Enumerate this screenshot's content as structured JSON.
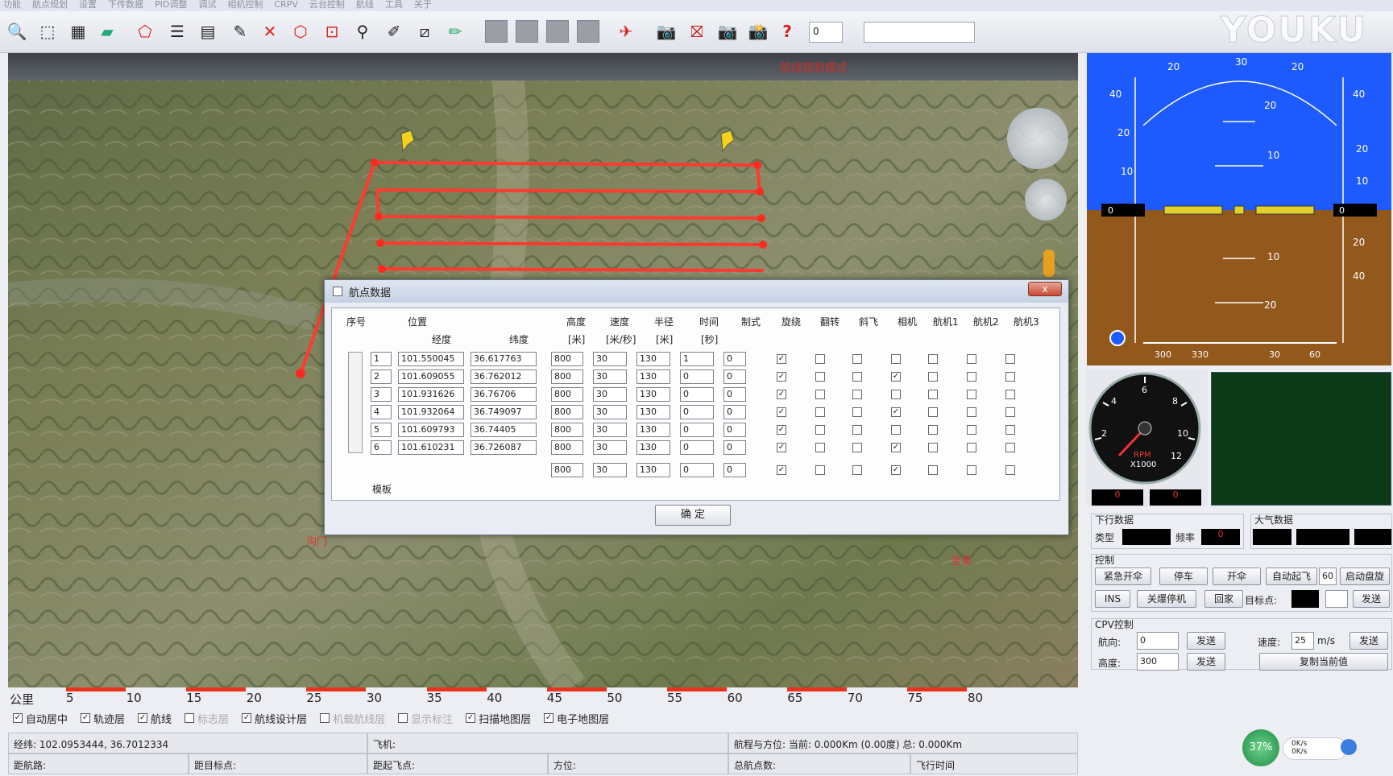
{
  "menu": [
    "功能",
    "航点规划",
    "设置",
    "下传数据",
    "PID调整",
    "调试",
    "相机控制",
    "CRPV",
    "云台控制",
    "航线",
    "工具",
    "关于"
  ],
  "toolbar": {
    "number_value": "0",
    "logo": "YOUKU"
  },
  "map": {
    "title": "航线规划模式",
    "landmarks": [
      "沟门",
      "宝泉"
    ]
  },
  "scale": {
    "unit": "公里",
    "ticks": [
      "5",
      "10",
      "15",
      "20",
      "25",
      "30",
      "35",
      "40",
      "45",
      "50",
      "55",
      "60",
      "65",
      "70",
      "75",
      "80"
    ]
  },
  "layers": [
    {
      "label": "自动居中",
      "checked": true
    },
    {
      "label": "轨迹层",
      "checked": true
    },
    {
      "label": "航线",
      "checked": true
    },
    {
      "label": "标志层",
      "checked": false,
      "dim": true
    },
    {
      "label": "航线设计层",
      "checked": true
    },
    {
      "label": "机载航线层",
      "checked": false,
      "dim": true
    },
    {
      "label": "显示标注",
      "checked": false,
      "dim": true
    },
    {
      "label": "扫描地图层",
      "checked": true
    },
    {
      "label": "电子地图层",
      "checked": true
    }
  ],
  "status": {
    "coords": "经纬: 102.0953444, 36.7012334",
    "plane": "飞机:",
    "range": "航程与方位: 当前: 0.000Km (0.00度) 总: 0.000Km",
    "waypoint_dist": "距航路:",
    "target": "距目标点:",
    "home": "距起飞点:",
    "heading": "方位:",
    "total_points": "总航点数:",
    "flight_time": "飞行时间"
  },
  "dialog": {
    "title": "航点数据",
    "close": "x",
    "ok": "确 定",
    "headers": {
      "index": "序号",
      "position": "位置",
      "lon": "经度",
      "lat": "纬度",
      "alt": "高度",
      "alt_u": "[米]",
      "speed": "速度",
      "speed_u": "[米/秒]",
      "radius": "半径",
      "radius_u": "[米]",
      "time": "时间",
      "time_u": "[秒]",
      "mode": "制式",
      "hover": "旋绕",
      "flip": "翻转",
      "tilt": "斜飞",
      "camera": "相机",
      "aux1": "航机1",
      "aux2": "航机2",
      "aux3": "航机3",
      "template": "模板"
    },
    "rows": [
      {
        "idx": "1",
        "lon": "101.550045",
        "lat": "36.617763",
        "alt": "800",
        "spd": "30",
        "rad": "130",
        "t": "1",
        "mode": "0",
        "cbs": [
          true,
          false,
          false,
          false,
          false,
          false,
          false
        ]
      },
      {
        "idx": "2",
        "lon": "101.609055",
        "lat": "36.762012",
        "alt": "800",
        "spd": "30",
        "rad": "130",
        "t": "0",
        "mode": "0",
        "cbs": [
          true,
          false,
          false,
          true,
          false,
          false,
          false
        ]
      },
      {
        "idx": "3",
        "lon": "101.931626",
        "lat": "36.76706",
        "alt": "800",
        "spd": "30",
        "rad": "130",
        "t": "0",
        "mode": "0",
        "cbs": [
          true,
          false,
          false,
          false,
          false,
          false,
          false
        ]
      },
      {
        "idx": "4",
        "lon": "101.932064",
        "lat": "36.749097",
        "alt": "800",
        "spd": "30",
        "rad": "130",
        "t": "0",
        "mode": "0",
        "cbs": [
          true,
          false,
          false,
          true,
          false,
          false,
          false
        ]
      },
      {
        "idx": "5",
        "lon": "101.609793",
        "lat": "36.74405",
        "alt": "800",
        "spd": "30",
        "rad": "130",
        "t": "0",
        "mode": "0",
        "cbs": [
          true,
          false,
          false,
          false,
          false,
          false,
          false
        ]
      },
      {
        "idx": "6",
        "lon": "101.610231",
        "lat": "36.726087",
        "alt": "800",
        "spd": "30",
        "rad": "130",
        "t": "0",
        "mode": "0",
        "cbs": [
          true,
          false,
          false,
          true,
          false,
          false,
          false
        ]
      }
    ],
    "template": {
      "alt": "800",
      "spd": "30",
      "rad": "130",
      "t": "0",
      "mode": "0",
      "cbs": [
        true,
        false,
        false,
        true,
        false,
        false,
        false
      ]
    }
  },
  "horizon": {
    "left_ticks": [
      "40",
      "20",
      "10"
    ],
    "right_ticks": [
      "40",
      "20",
      "10",
      "20",
      "40"
    ],
    "top_ticks": [
      "20",
      "30",
      "20"
    ],
    "pitch": [
      "20",
      "10",
      "10",
      "20"
    ],
    "left_readout": "0",
    "right_readout": "0",
    "compass": [
      "300",
      "330",
      "30",
      "60"
    ]
  },
  "rpm": {
    "label": "RPM",
    "scale": "X1000",
    "ticks": [
      "2",
      "4",
      "6",
      "8",
      "10",
      "12"
    ],
    "readout_left": "0",
    "readout_right": "0"
  },
  "downlink": {
    "title": "下行数据",
    "type_label": "类型",
    "freq_label": "频率",
    "freq_value": "0"
  },
  "atmos": {
    "title": "大气数据"
  },
  "control": {
    "title": "控制",
    "emergency": "紧急开伞",
    "stop": "停车",
    "open_chute": "开伞",
    "auto_takeoff": "自动起飞",
    "takeoff_value": "60",
    "auto_hover": "启动盘旋",
    "ins": "INS",
    "shutdown": "关爆停机",
    "return": "回家",
    "target_label": "目标点:",
    "send": "发送"
  },
  "cpv": {
    "title": "CPV控制",
    "heading": "航向:",
    "heading_val": "0",
    "speed": "速度:",
    "speed_val": "25",
    "speed_unit": "m/s",
    "altitude": "高度:",
    "alt_val": "300",
    "send": "发送",
    "copy": "复制当前值"
  },
  "taskbar": {
    "cpu": "37%",
    "up": "0K/s",
    "down": "0K/s"
  }
}
